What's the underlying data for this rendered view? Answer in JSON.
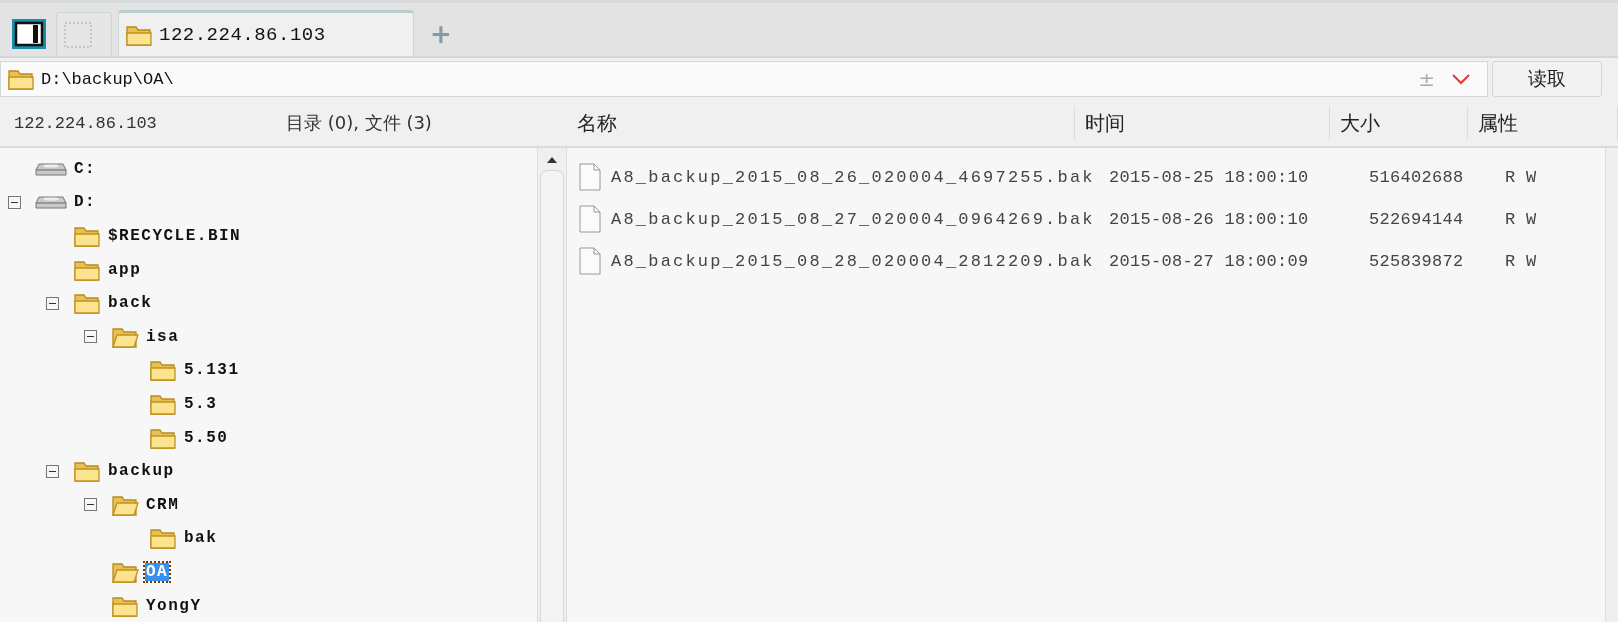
{
  "tabs": [
    {
      "kind": "panel",
      "selected": false
    },
    {
      "kind": "blank",
      "selected": false
    },
    {
      "kind": "folder",
      "label": "122.224.86.103",
      "selected": true
    }
  ],
  "new_tab": {
    "label": "+"
  },
  "address_bar": {
    "path": "D:\\backup\\OA\\",
    "toggle": "±",
    "read_button": "读取"
  },
  "left_header": {
    "host": "122.224.86.103",
    "summary": "目录 (0), 文件 (3)"
  },
  "tree": [
    {
      "label": "C:",
      "kind": "drive",
      "selected": false
    },
    {
      "label": "D:",
      "kind": "drive",
      "expanded": true,
      "selected": false,
      "children": [
        {
          "label": "$RECYCLE.BIN",
          "kind": "folder",
          "selected": false
        },
        {
          "label": "app",
          "kind": "folder",
          "selected": false
        },
        {
          "label": "back",
          "kind": "folder",
          "expanded": true,
          "selected": false,
          "children": [
            {
              "label": "isa",
              "kind": "folder",
              "expanded": true,
              "selected": false,
              "children": [
                {
                  "label": "5.131",
                  "kind": "folder",
                  "selected": false
                },
                {
                  "label": "5.3",
                  "kind": "folder",
                  "selected": false
                },
                {
                  "label": "5.50",
                  "kind": "folder",
                  "selected": false
                }
              ]
            }
          ]
        },
        {
          "label": "backup",
          "kind": "folder",
          "expanded": true,
          "selected": false,
          "children": [
            {
              "label": "CRM",
              "kind": "folder",
              "expanded": true,
              "selected": false,
              "children": [
                {
                  "label": "bak",
                  "kind": "folder",
                  "selected": false
                }
              ]
            },
            {
              "label": "OA",
              "kind": "folder",
              "selected": true
            },
            {
              "label": "YongY",
              "kind": "folder",
              "selected": false
            }
          ]
        }
      ]
    }
  ],
  "table": {
    "columns": [
      "名称",
      "时间",
      "大小",
      "属性"
    ],
    "rows": [
      {
        "name": "A8_backup_2015_08_26_020004_4697255.bak",
        "time": "2015-08-25 18:00:10",
        "size": "516402688",
        "attributes": "R W"
      },
      {
        "name": "A8_backup_2015_08_27_020004_0964269.bak",
        "time": "2015-08-26 18:00:10",
        "size": "522694144",
        "attributes": "R W"
      },
      {
        "name": "A8_backup_2015_08_28_020004_2812209.bak",
        "time": "2015-08-27 18:00:09",
        "size": "525839872",
        "attributes": "R W"
      }
    ]
  }
}
